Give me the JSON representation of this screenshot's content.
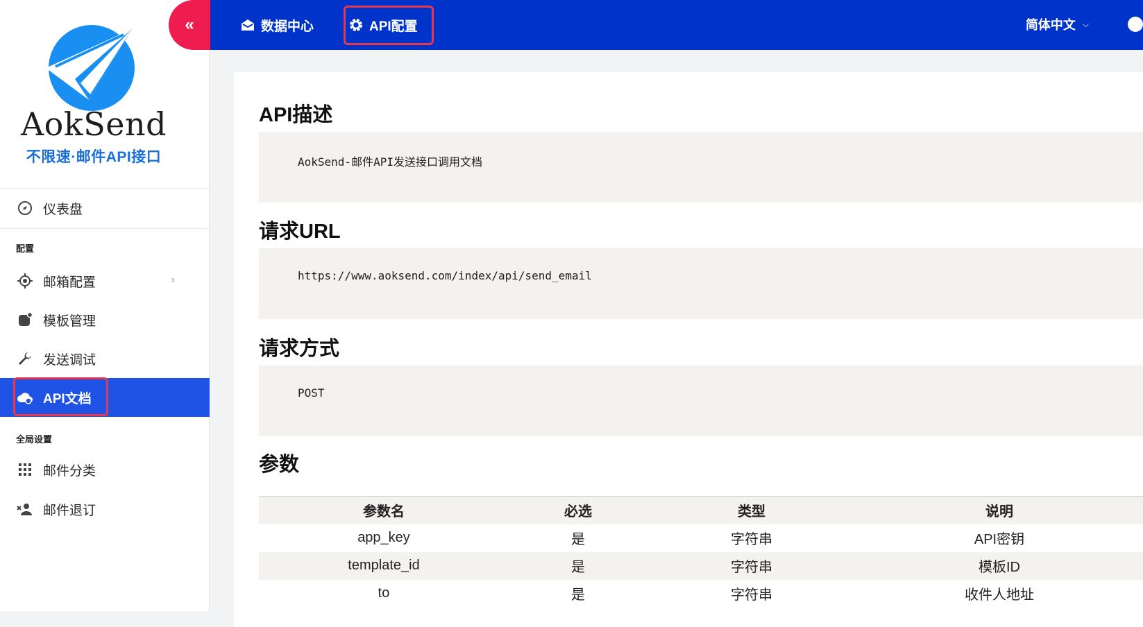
{
  "brand": {
    "name": "AokSend",
    "slogan": "不限速·邮件API接口",
    "color_primary": "#1a8ff2"
  },
  "topbar": {
    "collapse_icon": "«",
    "links": [
      {
        "label": "数据中心",
        "icon": "inbox-icon"
      },
      {
        "label": "API配置",
        "icon": "gear-icon"
      }
    ],
    "language": "简体中文",
    "bg_color": "#0033c9"
  },
  "sidebar": {
    "items": [
      {
        "label": "仪表盘",
        "icon": "compass-icon"
      },
      {
        "label": "邮箱配置",
        "icon": "target-icon"
      },
      {
        "label": "模板管理",
        "icon": "template-icon"
      },
      {
        "label": "发送调试",
        "icon": "wrench-icon"
      },
      {
        "label": "API文档",
        "icon": "cloud-icon",
        "active": true
      },
      {
        "label": "邮件分类",
        "icon": "grid-icon"
      },
      {
        "label": "邮件退订",
        "icon": "user-remove-icon"
      }
    ],
    "sections": {
      "config": "配置",
      "global": "全局设置"
    },
    "active_color": "#1f53e6"
  },
  "doc": {
    "api_desc": {
      "title": "API描述",
      "body": "AokSend-邮件API发送接口调用文档"
    },
    "request_url": {
      "title": "请求URL",
      "body": "https://www.aoksend.com/index/api/send_email"
    },
    "request_method": {
      "title": "请求方式",
      "body": "POST"
    },
    "params": {
      "title": "参数",
      "headers": [
        "参数名",
        "必选",
        "类型",
        "说明"
      ],
      "rows": [
        [
          "app_key",
          "是",
          "字符串",
          "API密钥"
        ],
        [
          "template_id",
          "是",
          "字符串",
          "模板ID"
        ],
        [
          "to",
          "是",
          "字符串",
          "收件人地址"
        ]
      ]
    }
  }
}
